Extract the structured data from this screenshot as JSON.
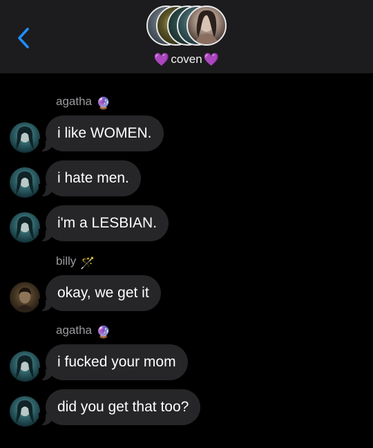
{
  "header": {
    "back_icon": "chevron-left-icon",
    "group_name": "coven",
    "heart_left": "💜",
    "heart_right": "💜",
    "accent_color": "#1f8fff",
    "avatar_count": 5
  },
  "messages": [
    {
      "sender": "agatha",
      "sender_emoji": "🔮",
      "avatar": "agatha",
      "text": "i like WOMEN."
    },
    {
      "sender": "",
      "avatar": "agatha",
      "text": "i hate men."
    },
    {
      "sender": "",
      "avatar": "agatha",
      "text": "i'm a LESBIAN."
    },
    {
      "sender": "billy",
      "sender_emoji": "🪄",
      "avatar": "billy",
      "text": "okay, we get it"
    },
    {
      "sender": "agatha",
      "sender_emoji": "🔮",
      "avatar": "agatha",
      "text": "i fucked your mom"
    },
    {
      "sender": "",
      "avatar": "agatha",
      "text": "did you get that too?"
    }
  ],
  "colors": {
    "header_bg": "#1c1c1e",
    "bubble_bg": "#262628",
    "sender_text": "#9b9ba0",
    "heart": "#a64bf4"
  }
}
